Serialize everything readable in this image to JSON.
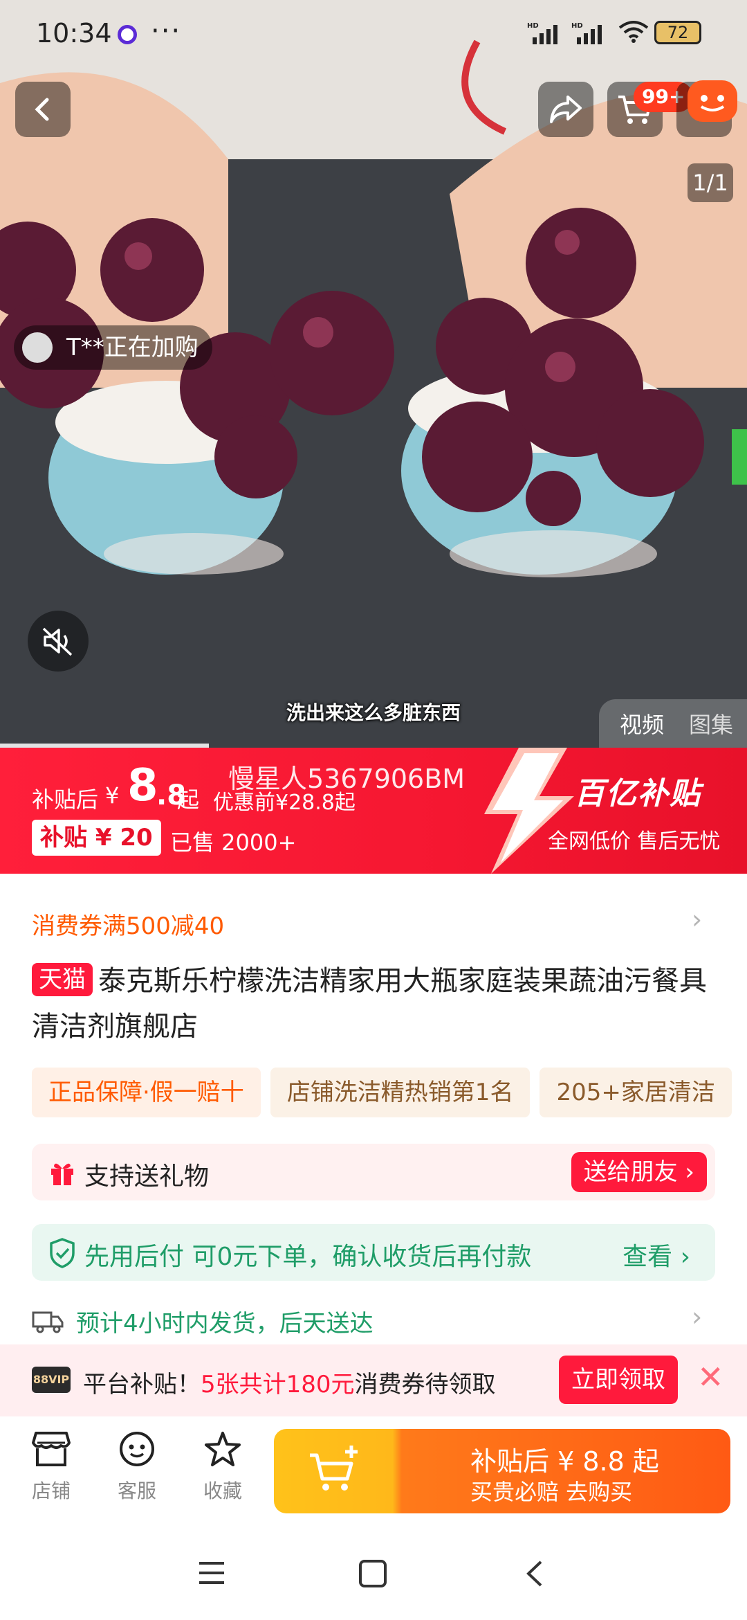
{
  "status_bar": {
    "time": "10:34",
    "more": "···",
    "signal_1": "HD",
    "signal_2": "HD",
    "battery": "72"
  },
  "media": {
    "cart_badge": "99+",
    "pager": "1/1",
    "buyer_ticker": "T**正在加购",
    "subtitle": "洗出来这么多脏东西",
    "tab_video": "视频",
    "tab_gallery": "图集",
    "progress": 0.28
  },
  "price_banner": {
    "label": "补贴后",
    "yen": "¥",
    "price_int": "8",
    "price_dec": ".8",
    "qi": "起",
    "original": "优惠前¥28.8起",
    "watermark": "慢星人5367906BM",
    "subsidy": "补贴 ¥ 20",
    "sold": "已售 2000+",
    "logo": "百亿补贴",
    "slogan": "全网低价  售后无忧"
  },
  "coupon": "消费券满500减40",
  "product": {
    "store_badge": "天猫",
    "title": "泰克斯乐柠檬洗洁精家用大瓶家庭装果蔬油污餐具清洁剂旗舰店"
  },
  "tags": [
    "正品保障·假一赔十",
    "店铺洗洁精热销第1名",
    "205+家居清洁"
  ],
  "gift": {
    "text": "支持送礼物",
    "button": "送给朋友 ›"
  },
  "pay_later": {
    "text": "先用后付 可0元下单，确认收货后再付款",
    "view": "查看 ›"
  },
  "shipping": "预计4小时内发货，后天送达",
  "promo": {
    "vip": "88VIP",
    "prefix": "平台补贴！",
    "highlight": "5张共计180元",
    "suffix": "消费券待领取",
    "button": "立即领取",
    "close": "✕"
  },
  "bottom_bar": {
    "shop": "店铺",
    "service": "客服",
    "favorite": "收藏",
    "buy_line1": "补贴后 ¥ 8.8 起",
    "buy_line2": "买贵必赔  去购买"
  },
  "colors": {
    "brand_red": "#ff1a3c",
    "green": "#1f9d68",
    "orange": "#ff5a00"
  }
}
